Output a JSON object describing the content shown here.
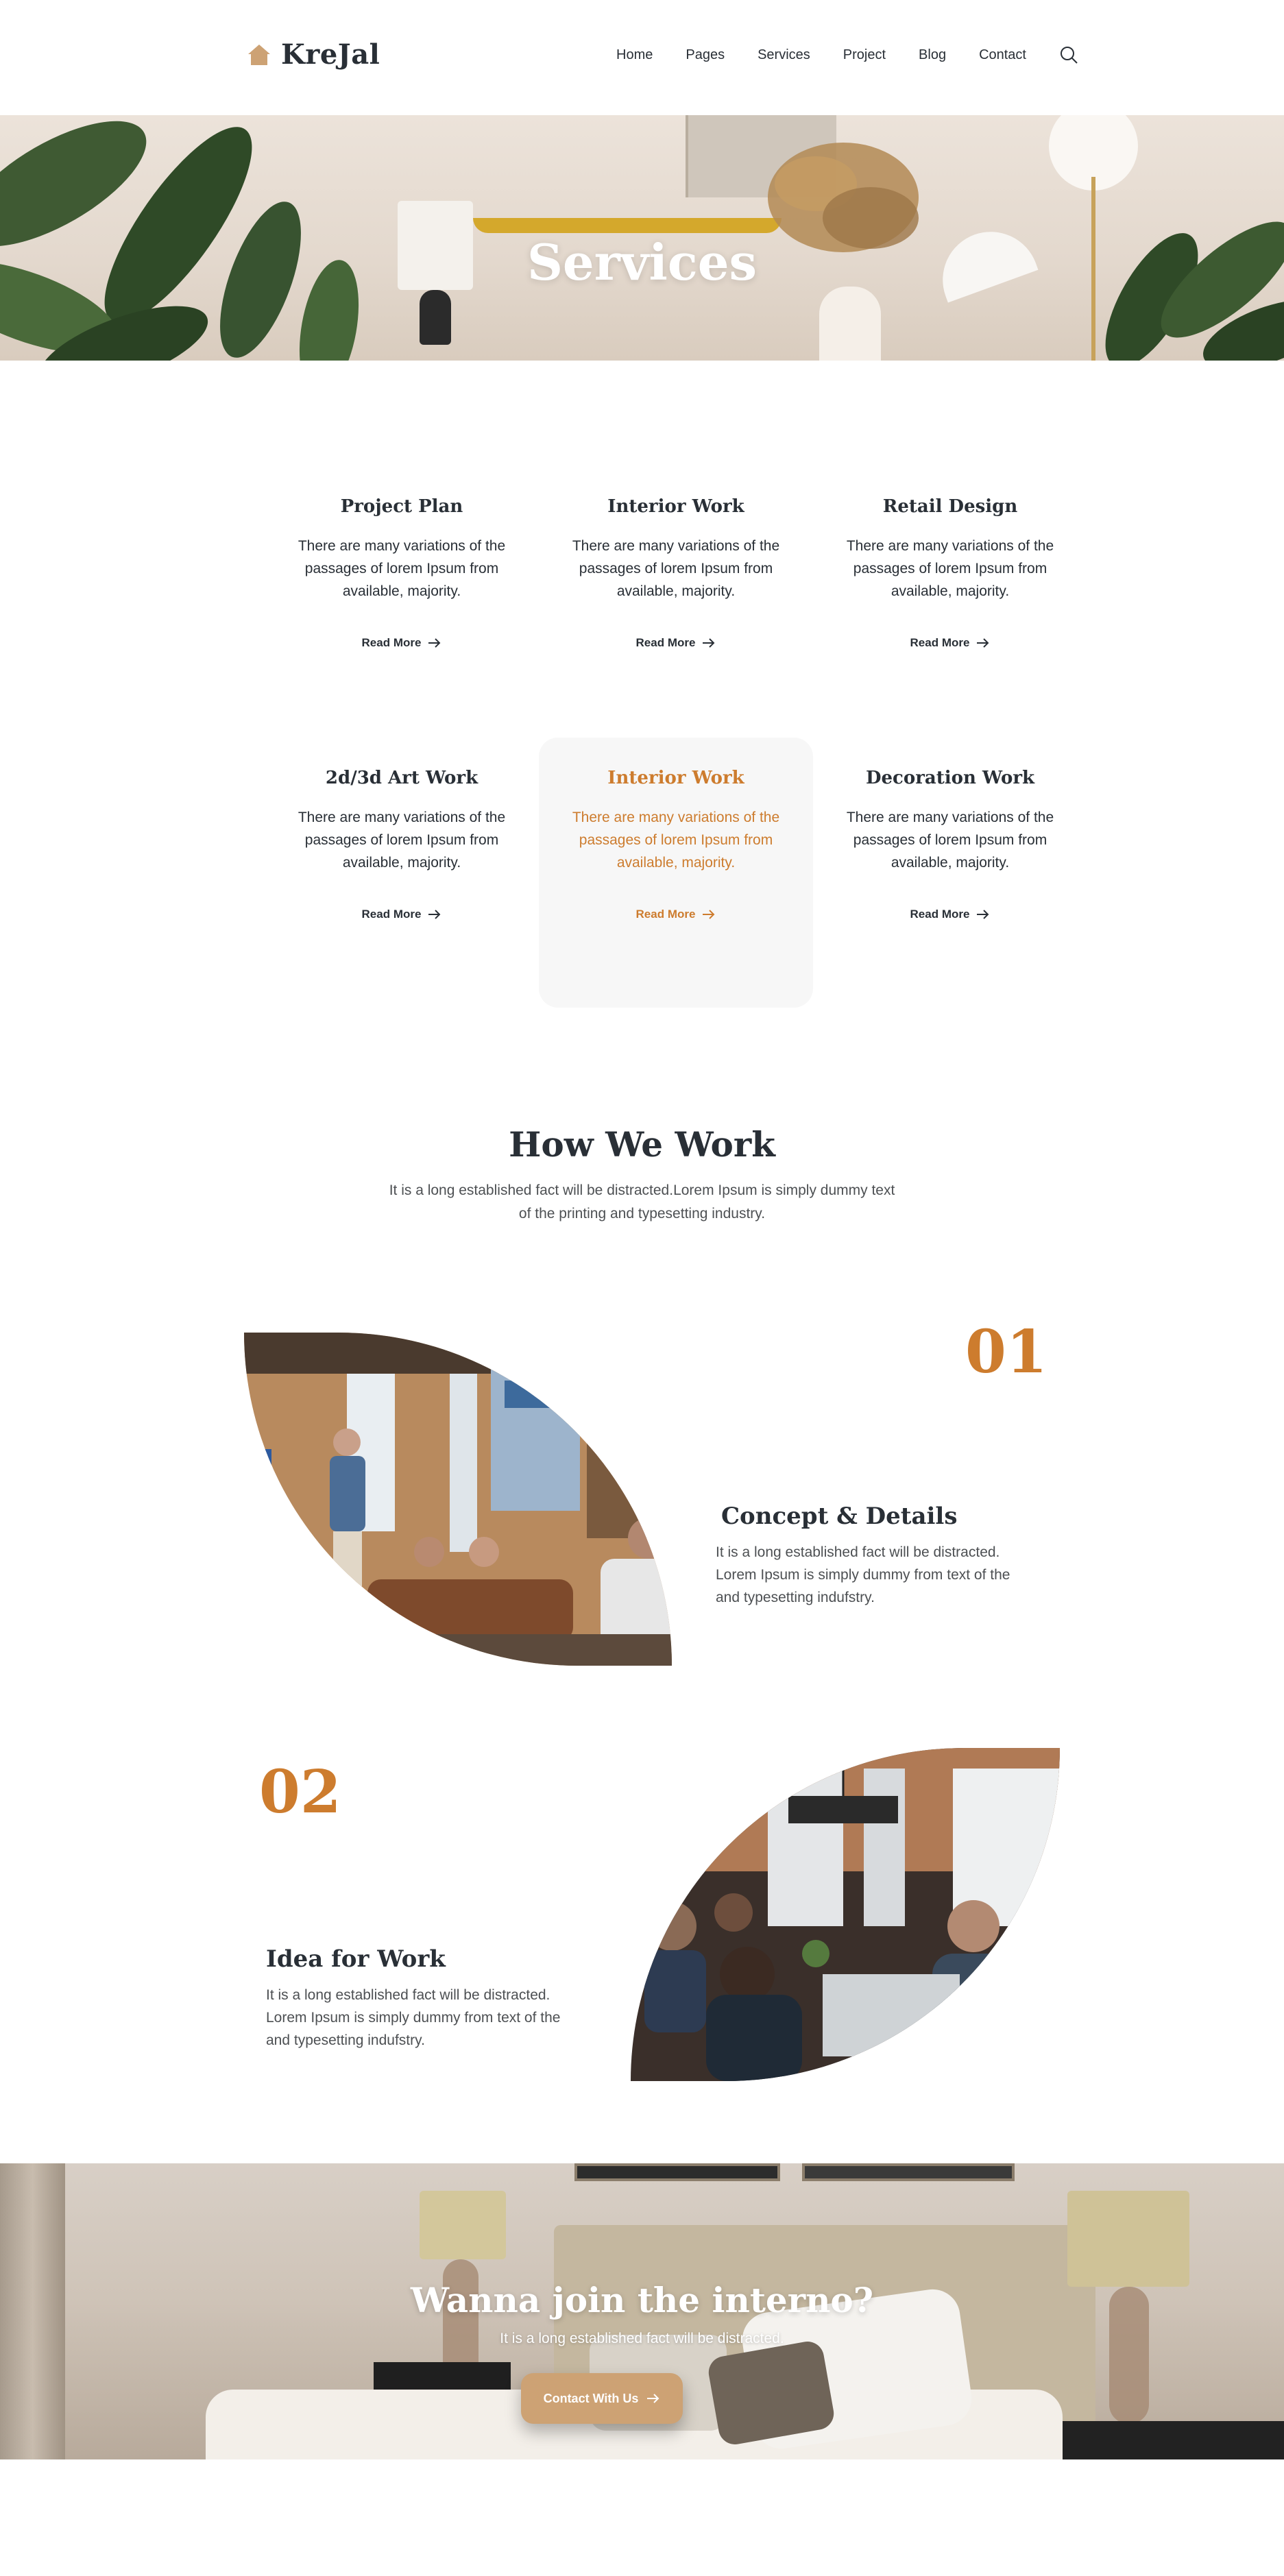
{
  "brand": {
    "name": "KreJal",
    "accent": "#CD7C2E",
    "button": "#CDA274",
    "dark": "#292F36"
  },
  "nav": {
    "items": [
      "Home",
      "Pages",
      "Services",
      "Project",
      "Blog",
      "Contact"
    ],
    "search_icon": "search-icon"
  },
  "hero": {
    "title": "Services"
  },
  "services": {
    "items": [
      {
        "title": "Project Plan",
        "desc": "There are many variations of the passages of lorem Ipsum from available, majority.",
        "link": "Read More"
      },
      {
        "title": "Interior Work",
        "desc": "There are many variations of the passages of lorem Ipsum from available, majority.",
        "link": "Read More"
      },
      {
        "title": "Retail Design",
        "desc": "There are many variations of the passages of lorem Ipsum from available, majority.",
        "link": "Read More"
      },
      {
        "title": "2d/3d Art Work",
        "desc": "There are many variations of the passages of lorem Ipsum from available, majority.",
        "link": "Read More"
      },
      {
        "title": "Interior Work",
        "desc": "There are many variations of the passages of lorem Ipsum from available, majority.",
        "link": "Read More"
      },
      {
        "title": "Decoration Work",
        "desc": "There are many variations of the passages of lorem Ipsum from available, majority.",
        "link": "Read More"
      }
    ]
  },
  "how": {
    "title": "How We Work",
    "subtitle": "It is a long established fact  will be distracted.Lorem Ipsum is simply dummy text of the printing and typesetting industry.",
    "steps": [
      {
        "number": "01",
        "title": "Concept & Details",
        "desc": "It is a long established fact  will be distracted. Lorem Ipsum is simply dummy from text of the and typesetting indufstry."
      },
      {
        "number": "02",
        "title": "Idea for Work",
        "desc": "It is a long established fact  will be distracted. Lorem Ipsum is simply dummy from text of the and typesetting indufstry."
      }
    ]
  },
  "cta": {
    "title": "Wanna join the interno?",
    "subtitle": "It is a long established fact  will be distracted.",
    "button": "Contact With Us"
  }
}
